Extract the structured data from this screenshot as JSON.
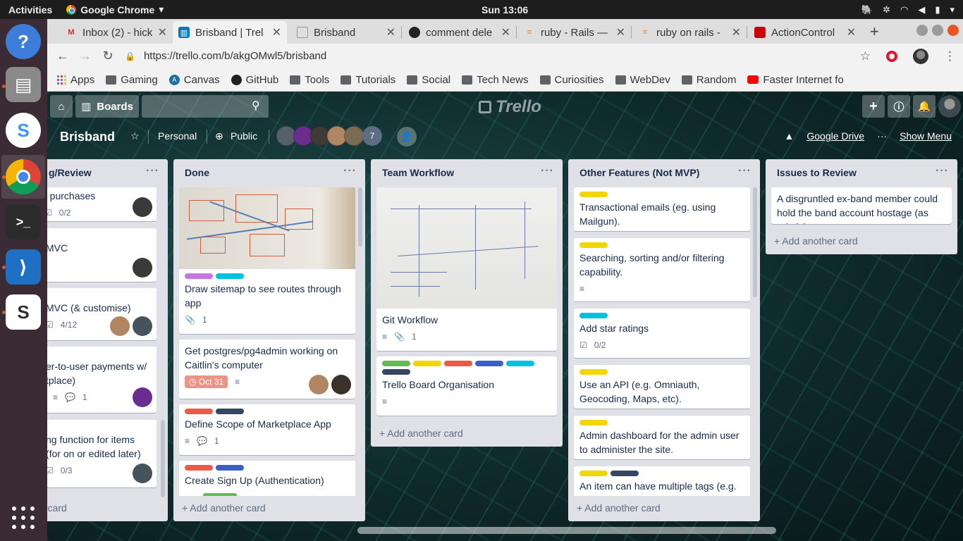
{
  "os": {
    "activities": "Activities",
    "app_name": "Google Chrome",
    "clock": "Sun 13:06"
  },
  "browser": {
    "tabs": [
      {
        "title": "Inbox (2) - hick",
        "icon": "gmail-icon"
      },
      {
        "title": "Brisband | Trel",
        "icon": "trello-icon"
      },
      {
        "title": "Brisband",
        "icon": "doc-icon"
      },
      {
        "title": "comment dele",
        "icon": "github-icon"
      },
      {
        "title": "ruby - Rails —",
        "icon": "stackoverflow-icon"
      },
      {
        "title": "ruby on rails -",
        "icon": "stackoverflow-icon"
      },
      {
        "title": "ActionControl",
        "icon": "rails-icon"
      }
    ],
    "url": "https://trello.com/b/akgOMwl5/brisband",
    "bookmarks": [
      "Apps",
      "Gaming",
      "Canvas",
      "GitHub",
      "Tools",
      "Tutorials",
      "Social",
      "Tech News",
      "Curiosities",
      "WebDev",
      "Random",
      "Faster Internet fo"
    ]
  },
  "trello": {
    "boards_label": "Boards",
    "search_placeholder": "",
    "logo": "Trello",
    "board_title": "Brisband",
    "visibility_team": "Personal",
    "visibility": "Public",
    "member_count": "7",
    "google_drive": "Google Drive",
    "show_menu": "Show Menu"
  },
  "lists": [
    {
      "title": "g/Review",
      "add_card": "r card",
      "cards": [
        {
          "title": "n purchases",
          "checklist": "0/2"
        },
        {
          "title": "MVC"
        },
        {
          "title": "MVC (& customise)",
          "checklist": "4/12"
        },
        {
          "title": "er-to-user payments w/ tplace)",
          "comments": "1"
        },
        {
          "title": "ng function for items (for on or edited later)",
          "checklist": "0/3"
        }
      ]
    },
    {
      "title": "Done",
      "add_card": "Add another card",
      "cards": [
        {
          "title": "Draw sitemap to see routes through app",
          "attachments": "1"
        },
        {
          "title": "Get postgres/pg4admin working on Caitlin's computer",
          "due": "Oct 31"
        },
        {
          "title": "Define Scope of Marketplace App",
          "comments": "1"
        },
        {
          "title": "Create Sign Up (Authentication)"
        }
      ]
    },
    {
      "title": "Team Workflow",
      "add_card": "Add another card",
      "cards": [
        {
          "title": "Git Workflow",
          "attachments": "1"
        },
        {
          "title": "Trello Board Organisation"
        }
      ]
    },
    {
      "title": "Other Features (Not MVP)",
      "add_card": "Add another card",
      "cards": [
        {
          "title": "Transactional emails (eg. using Mailgun)."
        },
        {
          "title": "Searching, sorting and/or filtering capability."
        },
        {
          "title": "Add star ratings",
          "checklist": "0/2"
        },
        {
          "title": "Use an API (e.g. Omniauth, Geocoding, Maps, etc)."
        },
        {
          "title": "Admin dashboard for the admin user to administer the site."
        },
        {
          "title": "An item can have multiple tags (e.g."
        }
      ]
    },
    {
      "title": "Issues to Review",
      "add_card": "Add another card",
      "cards": [
        {
          "title": "A disgruntled ex-band member could hold the band account hostage (as admin)"
        }
      ]
    }
  ],
  "colors": {
    "label_green": "#61bd4f",
    "label_yellow": "#f2d600",
    "label_red": "#eb5a46",
    "label_purple": "#c377e0",
    "label_blue": "#0079bf",
    "label_sky": "#00c2e0",
    "label_black": "#344563",
    "label_royal": "#3b5fc8",
    "due_overdue": "#ec9488",
    "list_bg": "#dfe1e6"
  }
}
